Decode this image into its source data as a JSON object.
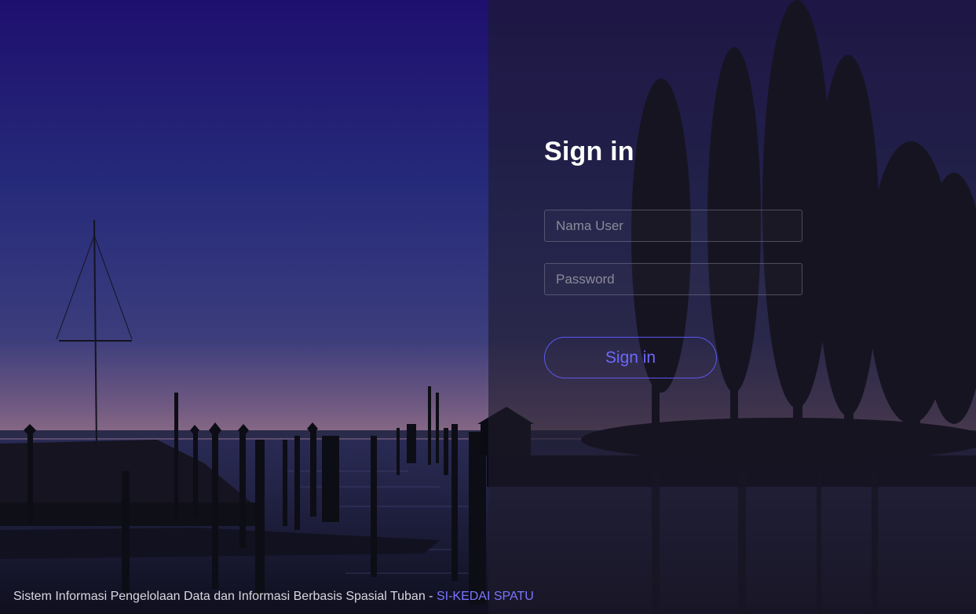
{
  "login": {
    "title": "Sign in",
    "username_placeholder": "Nama User",
    "password_placeholder": "Password",
    "submit_label": "Sign in"
  },
  "footer": {
    "text": "Sistem Informasi Pengelolaan Data dan Informasi Berbasis Spasial Tuban - ",
    "link_label": "SI-KEDAI SPATU"
  },
  "colors": {
    "accent": "#5b57f0",
    "sky_top": "#1e0f6e",
    "sky_horizon": "#8a6a86",
    "water": "#1b1a33"
  },
  "background": {
    "scene": "harbor-at-dusk-photo"
  }
}
